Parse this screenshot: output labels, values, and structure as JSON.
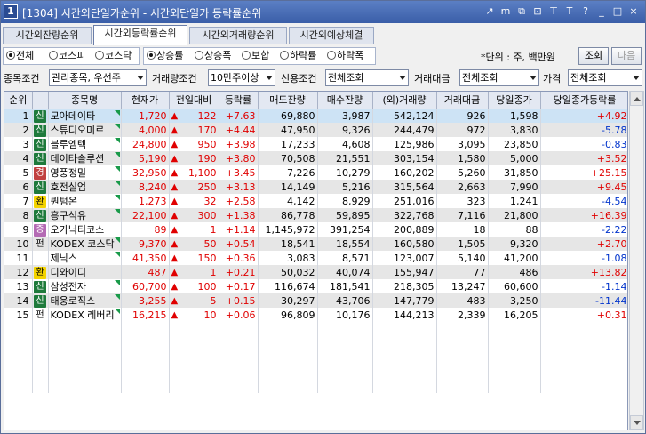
{
  "window": {
    "icon_label": "1",
    "title": "[1304] 시간외단일가순위 - 시간외단일가 등락률순위",
    "tools": [
      "↗",
      "m",
      "⧉",
      "⊡",
      "⊤",
      "T",
      "?",
      "_",
      "□",
      "×"
    ]
  },
  "tabs": [
    {
      "label": "시간외잔량순위",
      "active": false
    },
    {
      "label": "시간외등락률순위",
      "active": true
    },
    {
      "label": "시간외거래량순위",
      "active": false
    },
    {
      "label": "시간외예상체결",
      "active": false
    }
  ],
  "market_filter": [
    {
      "label": "전체",
      "checked": true
    },
    {
      "label": "코스피",
      "checked": false
    },
    {
      "label": "코스닥",
      "checked": false
    }
  ],
  "rank_filter": [
    {
      "label": "상승률",
      "checked": true
    },
    {
      "label": "상승폭",
      "checked": false
    },
    {
      "label": "보합",
      "checked": false
    },
    {
      "label": "하락률",
      "checked": false
    },
    {
      "label": "하락폭",
      "checked": false
    }
  ],
  "unit_text": "*단위 : 주, 백만원",
  "buttons": {
    "query": "조회",
    "next": "다음"
  },
  "conditions": {
    "stock_label": "종목조건",
    "stock_value": "관리종목, 우선주",
    "volume_label": "거래량조건",
    "volume_value": "10만주이상",
    "credit_label": "신용조건",
    "credit_value": "전체조회",
    "amount_label": "거래대금",
    "amount_value": "전체조회",
    "price_label": "가격",
    "price_value": "전체조회"
  },
  "table": {
    "headers": [
      "순위",
      "",
      "종목명",
      "현재가",
      "전일대비",
      "등락률",
      "매도잔량",
      "매수잔량",
      "(외)거래량",
      "거래대금",
      "당일종가",
      "당일종가등락률"
    ],
    "rows": [
      {
        "rank": "1",
        "badge": "신",
        "badge_type": "b-sin",
        "name": "모아데이타",
        "tri": true,
        "price": "1,720",
        "change": "122",
        "rate": "+7.63",
        "sell": "69,880",
        "buy": "3,987",
        "volume": "542,124",
        "amount": "926",
        "close": "1,598",
        "close_rate": "+4.92",
        "close_dir": "red"
      },
      {
        "rank": "2",
        "badge": "신",
        "badge_type": "b-sin",
        "name": "스튜디오미르",
        "tri": true,
        "price": "4,000",
        "change": "170",
        "rate": "+4.44",
        "sell": "47,950",
        "buy": "9,326",
        "volume": "244,479",
        "amount": "972",
        "close": "3,830",
        "close_rate": "-5.78",
        "close_dir": "blue"
      },
      {
        "rank": "3",
        "badge": "신",
        "badge_type": "b-sin",
        "name": "블루엠텍",
        "tri": true,
        "price": "24,800",
        "change": "950",
        "rate": "+3.98",
        "sell": "17,233",
        "buy": "4,608",
        "volume": "125,986",
        "amount": "3,095",
        "close": "23,850",
        "close_rate": "-0.83",
        "close_dir": "blue"
      },
      {
        "rank": "4",
        "badge": "신",
        "badge_type": "b-sin",
        "name": "데이타솔루션",
        "tri": true,
        "price": "5,190",
        "change": "190",
        "rate": "+3.80",
        "sell": "70,508",
        "buy": "21,551",
        "volume": "303,154",
        "amount": "1,580",
        "close": "5,000",
        "close_rate": "+3.52",
        "close_dir": "red"
      },
      {
        "rank": "5",
        "badge": "경",
        "badge_type": "b-gyeong",
        "name": "영풍정밀",
        "tri": true,
        "price": "32,950",
        "change": "1,100",
        "rate": "+3.45",
        "sell": "7,226",
        "buy": "10,279",
        "volume": "160,202",
        "amount": "5,260",
        "close": "31,850",
        "close_rate": "+25.15",
        "close_dir": "red"
      },
      {
        "rank": "6",
        "badge": "신",
        "badge_type": "b-sin",
        "name": "호전실업",
        "tri": true,
        "price": "8,240",
        "change": "250",
        "rate": "+3.13",
        "sell": "14,149",
        "buy": "5,216",
        "volume": "315,564",
        "amount": "2,663",
        "close": "7,990",
        "close_rate": "+9.45",
        "close_dir": "red"
      },
      {
        "rank": "7",
        "badge": "환",
        "badge_type": "b-hwan",
        "name": "퀀텀온",
        "tri": true,
        "price": "1,273",
        "change": "32",
        "rate": "+2.58",
        "sell": "4,142",
        "buy": "8,929",
        "volume": "251,016",
        "amount": "323",
        "close": "1,241",
        "close_rate": "-4.54",
        "close_dir": "blue"
      },
      {
        "rank": "8",
        "badge": "신",
        "badge_type": "b-sin",
        "name": "흥구석유",
        "tri": true,
        "price": "22,100",
        "change": "300",
        "rate": "+1.38",
        "sell": "86,778",
        "buy": "59,895",
        "volume": "322,768",
        "amount": "7,116",
        "close": "21,800",
        "close_rate": "+16.39",
        "close_dir": "red"
      },
      {
        "rank": "9",
        "badge": "증",
        "badge_type": "b-jeung",
        "name": "오가닉티코스",
        "tri": false,
        "price": "89",
        "change": "1",
        "rate": "+1.14",
        "sell": "1,145,972",
        "buy": "391,254",
        "volume": "200,889",
        "amount": "18",
        "close": "88",
        "close_rate": "-2.22",
        "close_dir": "blue"
      },
      {
        "rank": "10",
        "badge": "펀",
        "badge_type": "b-pyeon",
        "name": "KODEX 코스닥",
        "tri": true,
        "price": "9,370",
        "change": "50",
        "rate": "+0.54",
        "sell": "18,541",
        "buy": "18,554",
        "volume": "160,580",
        "amount": "1,505",
        "close": "9,320",
        "close_rate": "+2.70",
        "close_dir": "red"
      },
      {
        "rank": "11",
        "badge": "",
        "badge_type": "",
        "name": "제닉스",
        "tri": true,
        "price": "41,350",
        "change": "150",
        "rate": "+0.36",
        "sell": "3,083",
        "buy": "8,571",
        "volume": "123,007",
        "amount": "5,140",
        "close": "41,200",
        "close_rate": "-1.08",
        "close_dir": "blue"
      },
      {
        "rank": "12",
        "badge": "환",
        "badge_type": "b-hwan",
        "name": "디와이디",
        "tri": false,
        "price": "487",
        "change": "1",
        "rate": "+0.21",
        "sell": "50,032",
        "buy": "40,074",
        "volume": "155,947",
        "amount": "77",
        "close": "486",
        "close_rate": "+13.82",
        "close_dir": "red"
      },
      {
        "rank": "13",
        "badge": "신",
        "badge_type": "b-sin",
        "name": "삼성전자",
        "tri": true,
        "price": "60,700",
        "change": "100",
        "rate": "+0.17",
        "sell": "116,674",
        "buy": "181,541",
        "volume": "218,305",
        "amount": "13,247",
        "close": "60,600",
        "close_rate": "-1.14",
        "close_dir": "blue"
      },
      {
        "rank": "14",
        "badge": "신",
        "badge_type": "b-sin",
        "name": "태웅로직스",
        "tri": true,
        "price": "3,255",
        "change": "5",
        "rate": "+0.15",
        "sell": "30,297",
        "buy": "43,706",
        "volume": "147,779",
        "amount": "483",
        "close": "3,250",
        "close_rate": "-11.44",
        "close_dir": "blue"
      },
      {
        "rank": "15",
        "badge": "펀",
        "badge_type": "b-pyeon",
        "name": "KODEX 레버리",
        "tri": true,
        "price": "16,215",
        "change": "10",
        "rate": "+0.06",
        "sell": "96,809",
        "buy": "10,176",
        "volume": "144,213",
        "amount": "2,339",
        "close": "16,205",
        "close_rate": "+0.31",
        "close_dir": "red"
      }
    ]
  }
}
